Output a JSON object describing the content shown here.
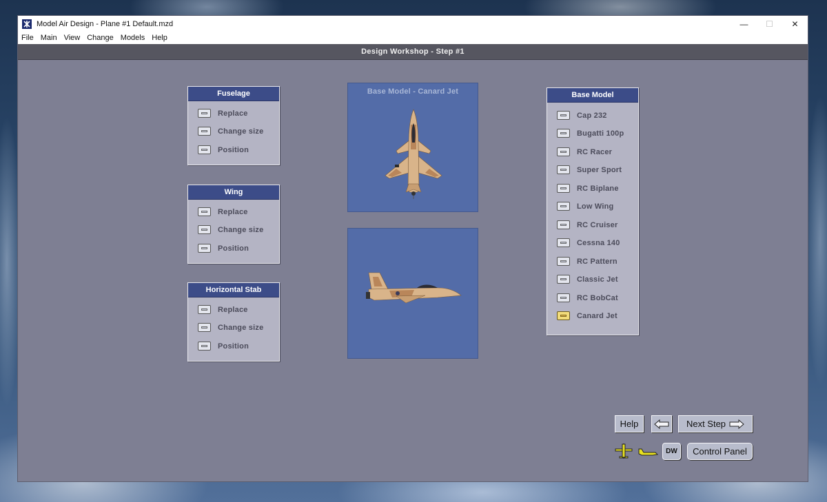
{
  "window": {
    "title": "Model Air Design - Plane #1  Default.mzd",
    "controls": [
      "minimize",
      "maximize",
      "close"
    ]
  },
  "menu": [
    "File",
    "Main",
    "View",
    "Change",
    "Models",
    "Help"
  ],
  "step_bar": {
    "title": "Design Workshop  -  Step #1"
  },
  "panels": {
    "fuselage": {
      "title": "Fuselage",
      "options": [
        "Replace",
        "Change size",
        "Position"
      ]
    },
    "wing": {
      "title": "Wing",
      "options": [
        "Replace",
        "Change size",
        "Position"
      ]
    },
    "hstab": {
      "title": "Horizontal Stab",
      "options": [
        "Replace",
        "Change size",
        "Position"
      ]
    }
  },
  "preview": {
    "top_caption": "Base Model  -  Canard Jet",
    "colors": {
      "panel_blue": "#536ca8",
      "camo_tan": "#d9b48a",
      "camo_brown": "#b9865a"
    }
  },
  "base_model": {
    "title": "Base Model",
    "selected": "Canard Jet",
    "models": [
      "Cap 232",
      "Bugatti 100p",
      "RC Racer",
      "Super Sport",
      "RC Biplane",
      "Low Wing",
      "RC Cruiser",
      "Cessna 140",
      "RC Pattern",
      "Classic Jet",
      "RC BobCat",
      "Canard Jet"
    ]
  },
  "nav": {
    "help": "Help",
    "back_icon": "arrow-left-icon",
    "next": "Next Step",
    "next_icon": "arrow-right-icon",
    "dw": "DW",
    "control_panel": "Control Panel",
    "plane_icon_top": "yellow-plane-top-icon",
    "plane_icon_side": "yellow-plane-side-icon"
  }
}
